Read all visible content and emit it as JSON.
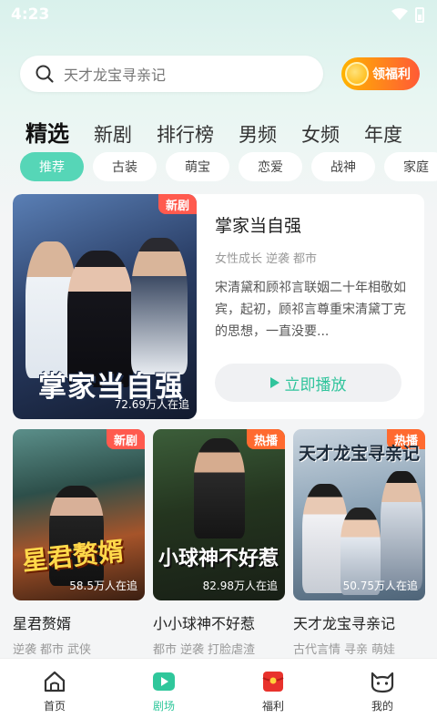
{
  "status_bar": {
    "time": "4:23"
  },
  "search": {
    "placeholder": "天才龙宝寻亲记"
  },
  "promo_button": {
    "label": "领福利"
  },
  "tabs": [
    {
      "label": "精选",
      "active": true
    },
    {
      "label": "新剧"
    },
    {
      "label": "排行榜"
    },
    {
      "label": "男频"
    },
    {
      "label": "女频"
    },
    {
      "label": "年度"
    }
  ],
  "chips": [
    {
      "label": "推荐",
      "active": true
    },
    {
      "label": "古装"
    },
    {
      "label": "萌宝"
    },
    {
      "label": "恋爱"
    },
    {
      "label": "战神"
    },
    {
      "label": "家庭"
    }
  ],
  "featured": {
    "badge": "新剧",
    "poster_title": "掌家当自强",
    "views": "72.69万人在追",
    "title": "掌家当自强",
    "tags": [
      "女性成长",
      "逆袭",
      "都市"
    ],
    "description": "宋清黛和顾祁言联姻二十年相敬如宾，起初，顾祁言尊重宋清黛丁克的思想，一直没要...",
    "play_label": "立即播放"
  },
  "cards": [
    {
      "badge": "新剧",
      "badge_type": "new",
      "poster_title": "星君赘婿",
      "views": "58.5万人在追",
      "title": "星君赘婿",
      "tags": [
        "逆袭",
        "都市",
        "武侠"
      ]
    },
    {
      "badge": "热播",
      "badge_type": "hot",
      "poster_title": "小球神不好惹",
      "views": "82.98万人在追",
      "title": "小小球神不好惹",
      "tags": [
        "都市",
        "逆袭",
        "打脸虐渣"
      ]
    },
    {
      "badge": "热播",
      "badge_type": "hot",
      "poster_title": "天才龙宝寻亲记",
      "views": "50.75万人在追",
      "title": "天才龙宝寻亲记",
      "tags": [
        "古代言情",
        "寻亲",
        "萌娃"
      ]
    }
  ],
  "tabbar": [
    {
      "label": "首页",
      "icon": "home-icon"
    },
    {
      "label": "剧场",
      "icon": "theater-icon",
      "active": true
    },
    {
      "label": "福利",
      "icon": "gift-envelope-icon"
    },
    {
      "label": "我的",
      "icon": "cat-profile-icon"
    }
  ],
  "colors": {
    "accent": "#2fc79b",
    "chip_active": "#56d6b7",
    "badge_new": "#ff5a4e",
    "badge_hot": "#ff6a2f"
  }
}
